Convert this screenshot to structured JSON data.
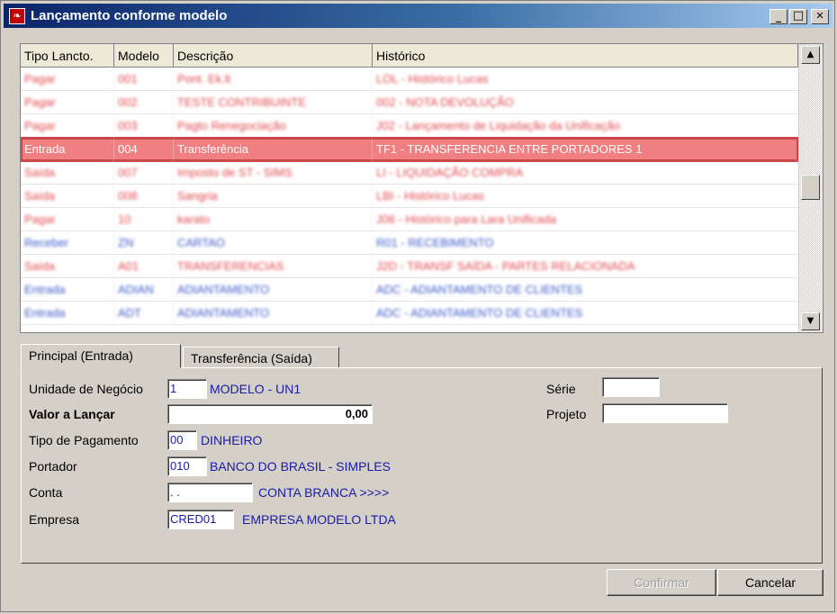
{
  "window": {
    "title": "Lançamento conforme modelo",
    "minimize": "_",
    "maximize": "□",
    "close": "✕"
  },
  "grid": {
    "columns": [
      "Tipo Lancto.",
      "Modelo",
      "Descrição",
      "Histórico"
    ],
    "rows": [
      {
        "tipo": "Pagar",
        "modelo": "001",
        "descricao": "Pont. Ek.lt",
        "historico": "LOL - Histórico Lucas",
        "color": "red"
      },
      {
        "tipo": "Pagar",
        "modelo": "002",
        "descricao": "TESTE CONTRIBUINTE",
        "historico": "002 - NOTA DEVOLUÇÃO",
        "color": "red"
      },
      {
        "tipo": "Pagar",
        "modelo": "003",
        "descricao": "Pagto Renegociação",
        "historico": "J02 - Lançamento de Liquidação da Unificação",
        "color": "red"
      },
      {
        "tipo": "Entrada",
        "modelo": "004",
        "descricao": "Transferência",
        "historico": "TF1  - TRANSFERENCIA ENTRE PORTADORES 1",
        "color": "selected"
      },
      {
        "tipo": "Saída",
        "modelo": "007",
        "descricao": "Imposto de ST - SIMS",
        "historico": "LI  - LIQUIDAÇÃO COMPRA",
        "color": "red"
      },
      {
        "tipo": "Saída",
        "modelo": "008",
        "descricao": "Sangria",
        "historico": "LBI - Histórico Lucas",
        "color": "red"
      },
      {
        "tipo": "Pagar",
        "modelo": "10",
        "descricao": "karato",
        "historico": "J06 - Histórico para Lara Unificada",
        "color": "red"
      },
      {
        "tipo": "Receber",
        "modelo": "ZN",
        "descricao": "CARTAO",
        "historico": "R01 - RECEBIMENTO",
        "color": "blue"
      },
      {
        "tipo": "Saída",
        "modelo": "A01",
        "descricao": "TRANSFERENCIAS",
        "historico": "J2D - TRANSF SAÍDA - PARTES RELACIONADA",
        "color": "red"
      },
      {
        "tipo": "Entrada",
        "modelo": "ADIAN",
        "descricao": "ADIANTAMENTO",
        "historico": "ADC - ADIANTAMENTO DE CLIENTES",
        "color": "blue"
      },
      {
        "tipo": "Entrada",
        "modelo": "ADT",
        "descricao": "ADIANTAMENTO",
        "historico": "ADC - ADIANTAMENTO DE CLIENTES",
        "color": "blue"
      }
    ]
  },
  "tabs": {
    "principal": "Principal (Entrada)",
    "transferencia": "Transferência (Saída)"
  },
  "form": {
    "unidade_label": "Unidade de Negócio",
    "unidade_value": "1",
    "unidade_desc": "MODELO - UN1",
    "valor_label": "Valor a Lançar",
    "valor_value": "0,00",
    "tipo_pag_label": "Tipo de Pagamento",
    "tipo_pag_value": "00",
    "tipo_pag_desc": "DINHEIRO",
    "portador_label": "Portador",
    "portador_value": "010",
    "portador_desc": "BANCO DO BRASIL - SIMPLES",
    "conta_label": "Conta",
    "conta_value": " .  .",
    "conta_desc": "CONTA BRANCA >>>>",
    "empresa_label": "Empresa",
    "empresa_value": "CRED01",
    "empresa_desc": "EMPRESA MODELO LTDA",
    "serie_label": "Série",
    "serie_value": "",
    "projeto_label": "Projeto",
    "projeto_value": ""
  },
  "buttons": {
    "confirmar": "Confirmar",
    "cancelar": "Cancelar"
  },
  "icons": {
    "app": "app-logo-icon",
    "scroll_up": "scroll-up-icon",
    "scroll_down": "scroll-down-icon"
  }
}
